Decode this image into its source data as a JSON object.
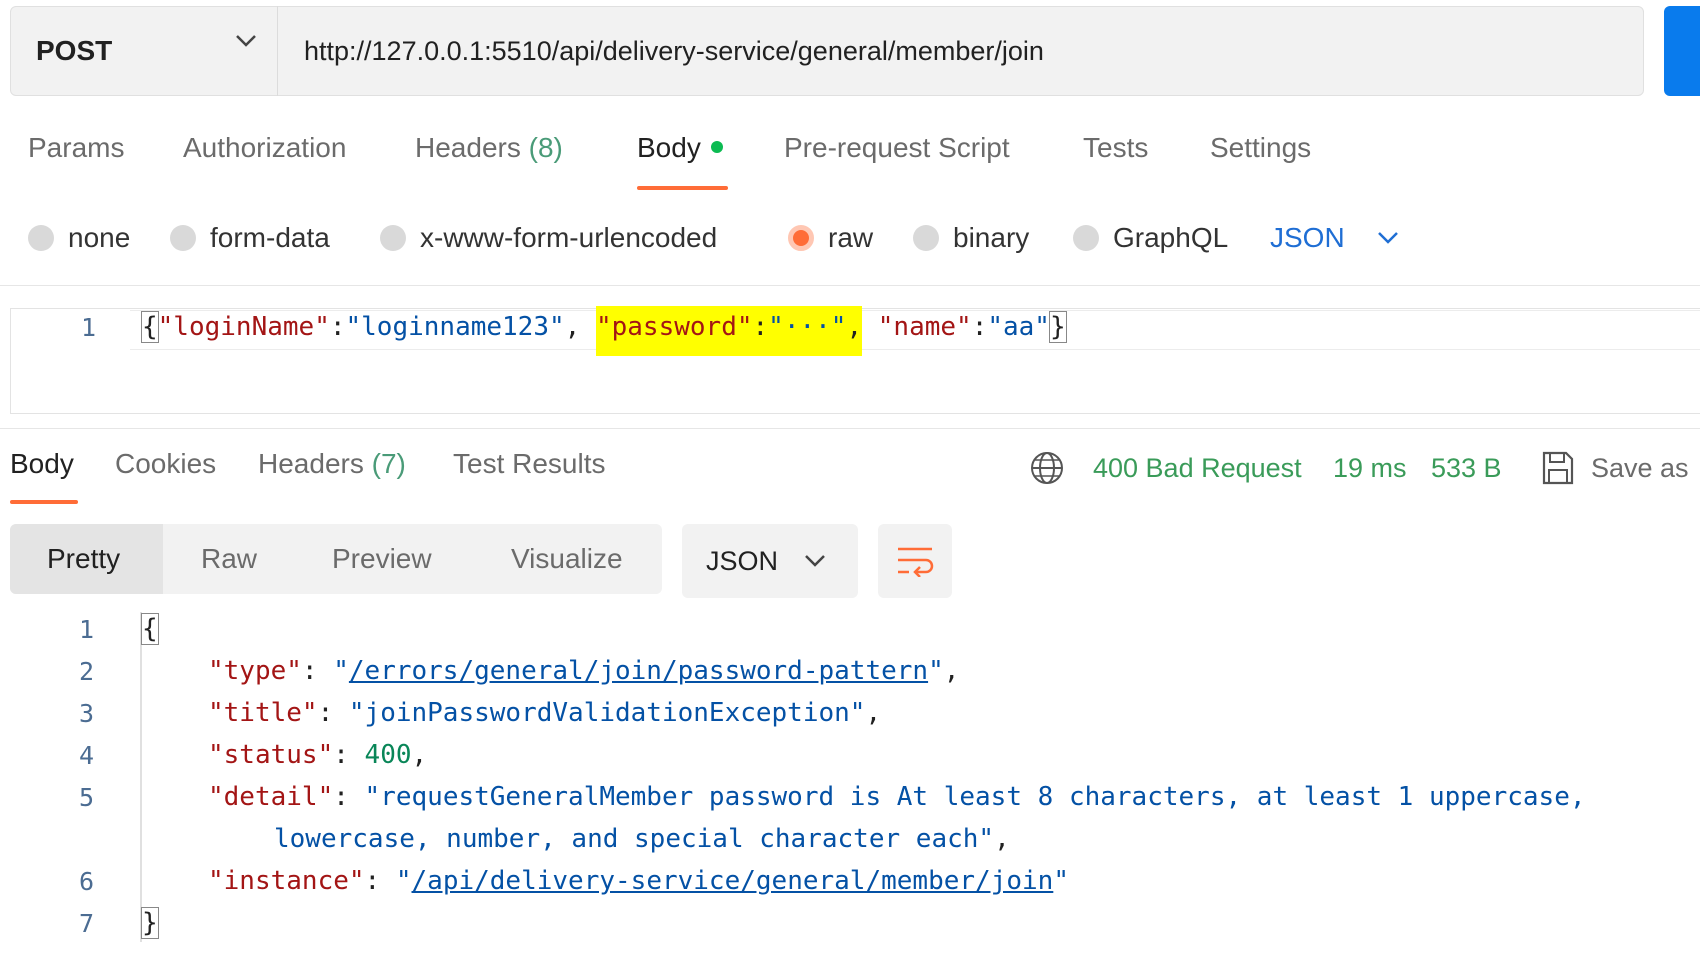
{
  "request": {
    "method": "POST",
    "url": "http://127.0.0.1:5510/api/delivery-service/general/member/join"
  },
  "request_tabs": {
    "params": "Params",
    "authorization": "Authorization",
    "headers": "Headers",
    "headers_count": "(8)",
    "body": "Body",
    "prerequest": "Pre-request Script",
    "tests": "Tests",
    "settings": "Settings"
  },
  "body_types": {
    "none": "none",
    "form_data": "form-data",
    "urlencoded": "x-www-form-urlencoded",
    "raw": "raw",
    "binary": "binary",
    "graphql": "GraphQL",
    "selected": "raw",
    "language": "JSON"
  },
  "request_body": {
    "line_number": "1",
    "open": "{",
    "key1": "\"loginName\"",
    "colon": ":",
    "val1": "\"loginname123\"",
    "comma": ",",
    "key2": "\"password\"",
    "val2": "\"···\"",
    "key3": "\"name\"",
    "val3": "\"aa\"",
    "close": "}"
  },
  "response_tabs": {
    "body": "Body",
    "cookies": "Cookies",
    "headers": "Headers",
    "headers_count": "(7)",
    "test_results": "Test Results"
  },
  "response_status": {
    "status": "400 Bad Request",
    "time": "19 ms",
    "size": "533 B",
    "save_as": "Save as"
  },
  "response_view": {
    "pretty": "Pretty",
    "raw": "Raw",
    "preview": "Preview",
    "visualize": "Visualize",
    "format": "JSON"
  },
  "response_body": {
    "line_numbers": [
      "1",
      "2",
      "3",
      "4",
      "5",
      "",
      "6",
      "7"
    ],
    "open": "{",
    "type_key": "\"type\"",
    "type_val": "/errors/general/join/password-pattern",
    "title_key": "\"title\"",
    "title_val": "\"joinPasswordValidationException\"",
    "status_key": "\"status\"",
    "status_val": "400",
    "detail_key": "\"detail\"",
    "detail_val_1": "\"requestGeneralMember password is At least 8 characters, at least 1 uppercase,",
    "detail_val_2": "lowercase, number, and special character each\"",
    "instance_key": "\"instance\"",
    "instance_val": "/api/delivery-service/general/member/join",
    "close": "}"
  },
  "colors": {
    "accent": "#ff6c37",
    "status_green": "#3a9b59",
    "link_blue": "#1f6ed4",
    "send_blue": "#097bed"
  }
}
